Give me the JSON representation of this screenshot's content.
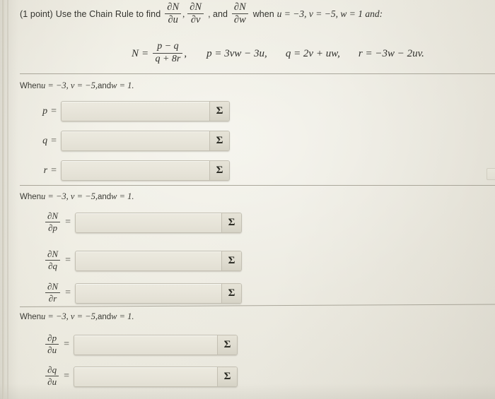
{
  "problem": {
    "points_label": "(1 point)",
    "prompt_lead": "Use the Chain Rule to find",
    "derivative_1": {
      "num": "∂N",
      "den": "∂u"
    },
    "derivative_2": {
      "num": "∂N",
      "den": "∂v"
    },
    "derivative_3": {
      "num": "∂N",
      "den": "∂w"
    },
    "and_word": ", and",
    "comma_1": ",",
    "when_word": "when",
    "condition_text": "u = −3, v = −5, w = 1 and:"
  },
  "equation": {
    "N_label": "N",
    "equals": "=",
    "fraction_num": "p − q",
    "fraction_den": "q + 8r",
    "fraction_comma": ",",
    "p_def": "p = 3vw − 3u,",
    "q_def": "q = 2v + uw,",
    "r_def": "r = −3w − 2uv."
  },
  "sections": [
    {
      "id": "values",
      "when_prefix": "When ",
      "when_math": "u = −3, v = −5,",
      "when_and": " and ",
      "when_tail": "w = 1.",
      "rows": [
        {
          "label_type": "plain",
          "label": "p",
          "equals": "=",
          "value": "",
          "placeholder": "",
          "sigma": "Σ"
        },
        {
          "label_type": "plain",
          "label": "q",
          "equals": "=",
          "value": "",
          "placeholder": "",
          "sigma": "Σ"
        },
        {
          "label_type": "plain",
          "label": "r",
          "equals": "=",
          "value": "",
          "placeholder": "",
          "sigma": "Σ"
        }
      ]
    },
    {
      "id": "partials-N",
      "when_prefix": "When ",
      "when_math": "u = −3, v = −5,",
      "when_and": " and ",
      "when_tail": "w = 1.",
      "rows": [
        {
          "label_type": "frac",
          "num": "∂N",
          "den": "∂p",
          "equals": "=",
          "value": "",
          "placeholder": "",
          "sigma": "Σ"
        },
        {
          "label_type": "frac",
          "num": "∂N",
          "den": "∂q",
          "equals": "=",
          "value": "",
          "placeholder": "",
          "sigma": "Σ"
        },
        {
          "label_type": "frac",
          "num": "∂N",
          "den": "∂r",
          "equals": "=",
          "value": "",
          "placeholder": "",
          "sigma": "Σ"
        }
      ]
    },
    {
      "id": "partials-u",
      "when_prefix": "When ",
      "when_math": "u = −3, v = −5,",
      "when_and": " and ",
      "when_tail": "w = 1.",
      "rows": [
        {
          "label_type": "frac",
          "num": "∂p",
          "den": "∂u",
          "equals": "=",
          "value": "",
          "placeholder": "",
          "sigma": "Σ"
        },
        {
          "label_type": "frac",
          "num": "∂q",
          "den": "∂u",
          "equals": "=",
          "value": "",
          "placeholder": "",
          "sigma": "Σ"
        }
      ]
    }
  ],
  "colors": {
    "paper": "#e9e7de",
    "ink": "#2b2b28",
    "divider": "#9e9a8d",
    "field_border": "#c3bfb2"
  }
}
